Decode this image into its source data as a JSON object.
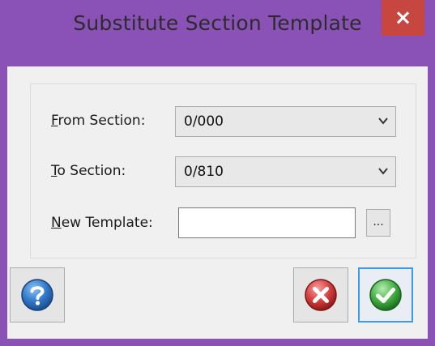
{
  "window": {
    "title": "Substitute Section Template",
    "close_glyph": "×"
  },
  "form": {
    "from_section": {
      "label_accel": "F",
      "label_rest": "rom Section:",
      "value": "0/000"
    },
    "to_section": {
      "label_accel": "T",
      "label_rest": "o Section:",
      "value": "0/810"
    },
    "new_template": {
      "label_accel": "N",
      "label_rest": "ew Template:",
      "value": "",
      "browse_label": "..."
    }
  },
  "buttons": {
    "help_icon": "help-icon",
    "cancel_icon": "cancel-icon",
    "ok_icon": "ok-check-icon"
  },
  "colors": {
    "title_bar": "#8a52b6",
    "close_button": "#c7463f",
    "focus_border": "#3c9ae6",
    "help_blue": "#2f77c9",
    "cancel_red": "#d53b3b",
    "ok_green": "#3fae3f"
  }
}
